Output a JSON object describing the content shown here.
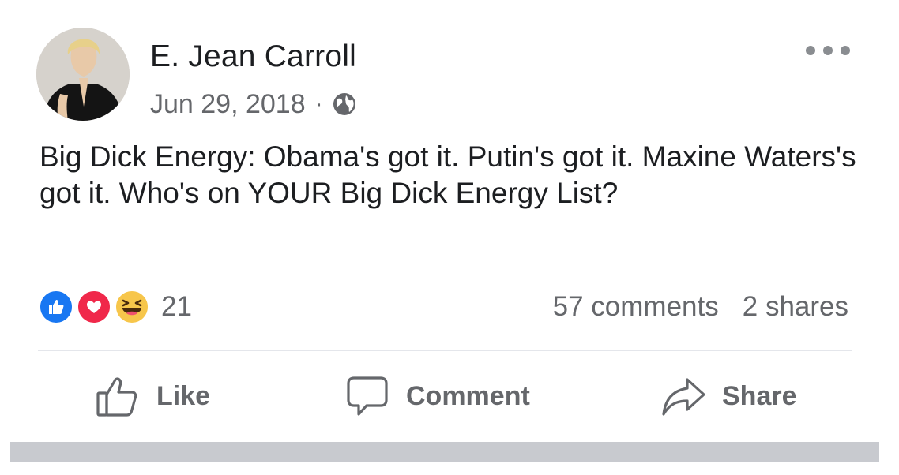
{
  "post": {
    "author": "E. Jean Carroll",
    "date": "Jun 29, 2018",
    "separator": "·",
    "privacy_icon": "globe-icon",
    "more_icon": "more-options-icon",
    "text": "Big Dick Energy: Obama's got it. Putin's got it. Maxine Waters's got it. Who's on YOUR Big Dick Energy List?"
  },
  "engagement": {
    "reaction_icons": [
      "like-reaction-icon",
      "love-reaction-icon",
      "haha-reaction-icon"
    ],
    "reaction_count": "21",
    "comments": "57 comments",
    "shares": "2 shares"
  },
  "actions": {
    "like_label": "Like",
    "comment_label": "Comment",
    "share_label": "Share"
  },
  "colors": {
    "like_blue": "#1877f2",
    "love_red": "#f0284a",
    "haha_yellow": "#f7c64b",
    "secondary_text": "#65676b",
    "divider": "#e4e6eb"
  }
}
